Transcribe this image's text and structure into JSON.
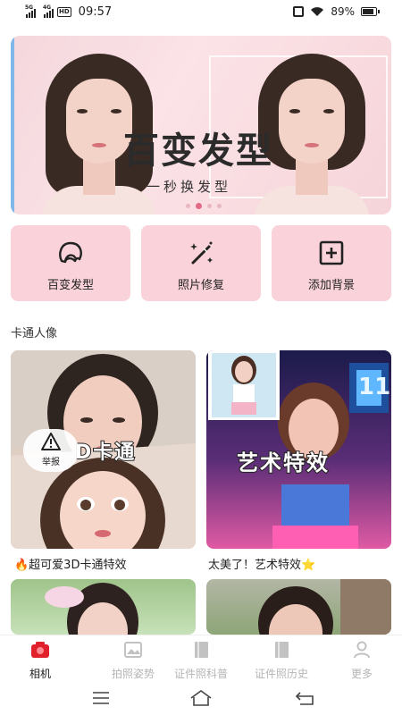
{
  "status_bar": {
    "sim1_label": "5G",
    "sim2_label": "4G",
    "hd_label": "HD",
    "time": "09:57",
    "battery_text": "89%",
    "battery_level": 0.89
  },
  "banner": {
    "title": "百变发型",
    "subtitle": "一秒换发型",
    "slide_count": 4,
    "active_slide": 1
  },
  "features": [
    {
      "label": "百变发型",
      "icon": "hairstyle-icon"
    },
    {
      "label": "照片修复",
      "icon": "magic-wand-icon"
    },
    {
      "label": "添加背景",
      "icon": "add-square-icon"
    }
  ],
  "section": {
    "title": "卡通人像"
  },
  "cards": [
    {
      "overlay_text": "D卡通",
      "caption": "🔥超可爱3D卡通特效"
    },
    {
      "overlay_text": "艺术特效",
      "caption": "太美了！艺术特效⭐",
      "sign_text": "11"
    },
    {
      "overlay_text": "",
      "caption": ""
    },
    {
      "overlay_text": "",
      "caption": ""
    }
  ],
  "report": {
    "label": "举报"
  },
  "tabs": [
    {
      "label": "相机",
      "active": true,
      "icon": "camera-icon"
    },
    {
      "label": "拍照姿势",
      "active": false,
      "icon": "image-icon"
    },
    {
      "label": "证件照科普",
      "active": false,
      "icon": "book-icon"
    },
    {
      "label": "证件照历史",
      "active": false,
      "icon": "history-book-icon"
    },
    {
      "label": "更多",
      "active": false,
      "icon": "person-icon"
    }
  ],
  "colors": {
    "banner_bg": "#f4d7dc",
    "feature_bg": "#f9d3d9",
    "accent": "#e46a86",
    "active_tab_icon": "#e0202a",
    "inactive_tab": "#b5b5b5"
  }
}
